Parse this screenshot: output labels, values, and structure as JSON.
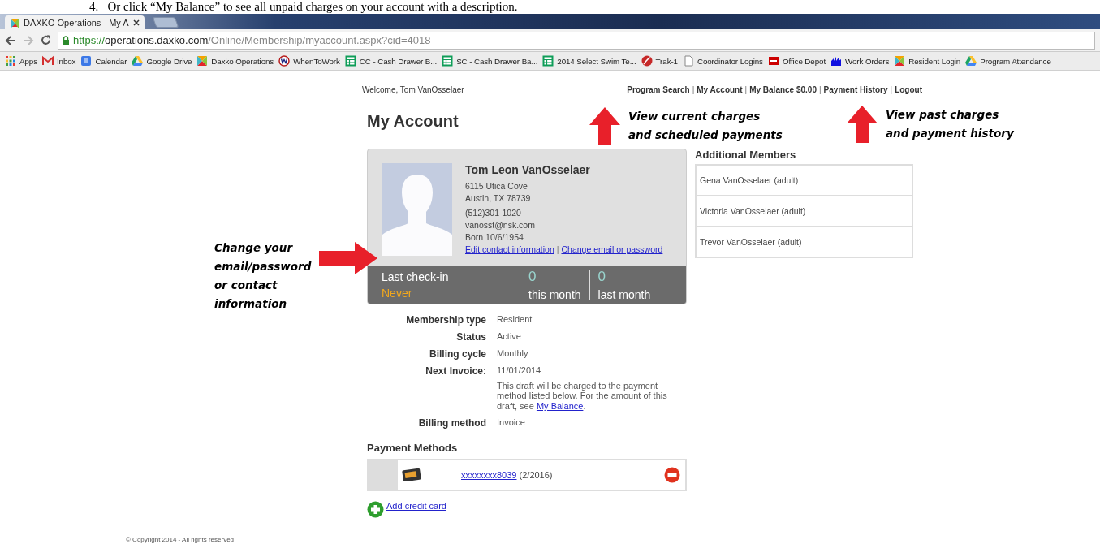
{
  "caption": "4.   Or click “My Balance” to see all unpaid charges on your account with a description.",
  "browser": {
    "tabs": [
      {
        "title": "DAXKO Operations - My A",
        "selected": true
      }
    ],
    "url": {
      "scheme": "https://",
      "host": "operations.daxko.com",
      "path": "/Online/Membership/myaccount.aspx?cid=4018"
    },
    "bookmarks": [
      {
        "label": "Apps",
        "kind": "apps"
      },
      {
        "label": "Inbox",
        "kind": "mail"
      },
      {
        "label": "Calendar",
        "kind": "calendar"
      },
      {
        "label": "Google Drive",
        "kind": "drive"
      },
      {
        "label": "Daxko Operations",
        "kind": "daxko"
      },
      {
        "label": "WhenToWork",
        "kind": "w"
      },
      {
        "label": "CC - Cash Drawer B...",
        "kind": "sheet"
      },
      {
        "label": "SC - Cash Drawer Ba...",
        "kind": "sheet"
      },
      {
        "label": "2014 Select Swim Te...",
        "kind": "sheet"
      },
      {
        "label": "Trak-1",
        "kind": "trak"
      },
      {
        "label": "Coordinator Logins",
        "kind": "page"
      },
      {
        "label": "Office Depot",
        "kind": "office"
      },
      {
        "label": "Work Orders",
        "kind": "works"
      },
      {
        "label": "Resident Login",
        "kind": "daxko"
      },
      {
        "label": "Program Attendance",
        "kind": "drive"
      }
    ]
  },
  "page": {
    "welcome": "Welcome, Tom VanOsselaer",
    "nav_links": [
      "Program Search",
      "My Account",
      "My Balance $0.00",
      "Payment History",
      "Logout"
    ],
    "separator": "|",
    "title": "My Account",
    "annotations": [
      {
        "kind": "up",
        "lines": [
          "View current charges",
          "and scheduled payments"
        ]
      },
      {
        "kind": "up",
        "lines": [
          "View past charges",
          "and payment history"
        ]
      },
      {
        "kind": "right",
        "lines": [
          "Change your",
          "email/password",
          "or contact",
          "information"
        ]
      }
    ],
    "profile": {
      "name": "Tom Leon VanOsselaer",
      "address": [
        "6115 Utica Cove",
        "Austin,  TX  78739"
      ],
      "contact": [
        "(512)301-1020",
        "vanosst@nsk.com",
        "Born 10/6/1954"
      ],
      "links": [
        "Edit contact information",
        "Change email or password"
      ]
    },
    "stats": {
      "label": "Last check-in",
      "value": "Never",
      "counts": [
        {
          "count": "0",
          "label": "this month"
        },
        {
          "count": "0",
          "label": "last month"
        }
      ]
    },
    "details": [
      {
        "label": "Membership type",
        "value": "Resident"
      },
      {
        "label": "Status",
        "value": "Active"
      },
      {
        "label": "Billing cycle",
        "value": "Monthly"
      },
      {
        "label": "Next Invoice:",
        "value": "11/01/2014",
        "note": {
          "before": "This draft will be charged to the payment method listed below. For the amount of this draft, see ",
          "link": "My Balance",
          "after": "."
        }
      },
      {
        "label": "Billing method",
        "value": "Invoice"
      }
    ],
    "payment_methods": {
      "title": "Payment Methods",
      "cards": [
        {
          "number": "xxxxxxxx8039",
          "expiry": "(2/2016)"
        }
      ],
      "add": "Add credit card"
    },
    "members": {
      "title": "Additional Members",
      "items": [
        "Gena VanOsselaer (adult)",
        "Victoria VanOsselaer (adult)",
        "Trevor VanOsselaer (adult)"
      ]
    },
    "footer": "© Copyright 2014 - All rights reserved"
  }
}
